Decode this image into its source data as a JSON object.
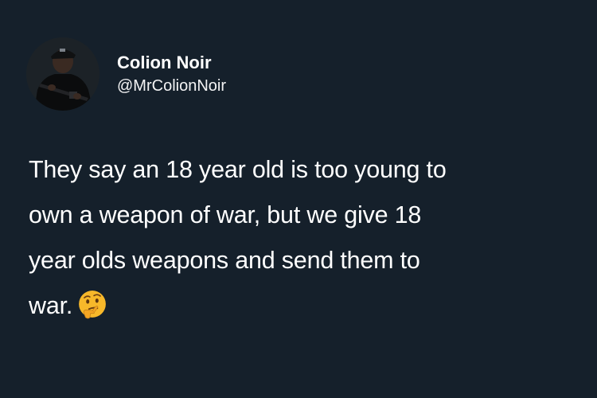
{
  "user": {
    "display_name": "Colion Noir",
    "handle": "@MrColionNoir"
  },
  "tweet": {
    "lines": [
      "They say an 18 year old is too young to",
      "own a weapon of war, but we give 18",
      "year olds weapons and send them to",
      "war."
    ],
    "emoji": "thinking-face-icon"
  },
  "colors": {
    "background": "#15202b",
    "text": "#ffffff",
    "emoji_yellow": "#f7b82a"
  }
}
